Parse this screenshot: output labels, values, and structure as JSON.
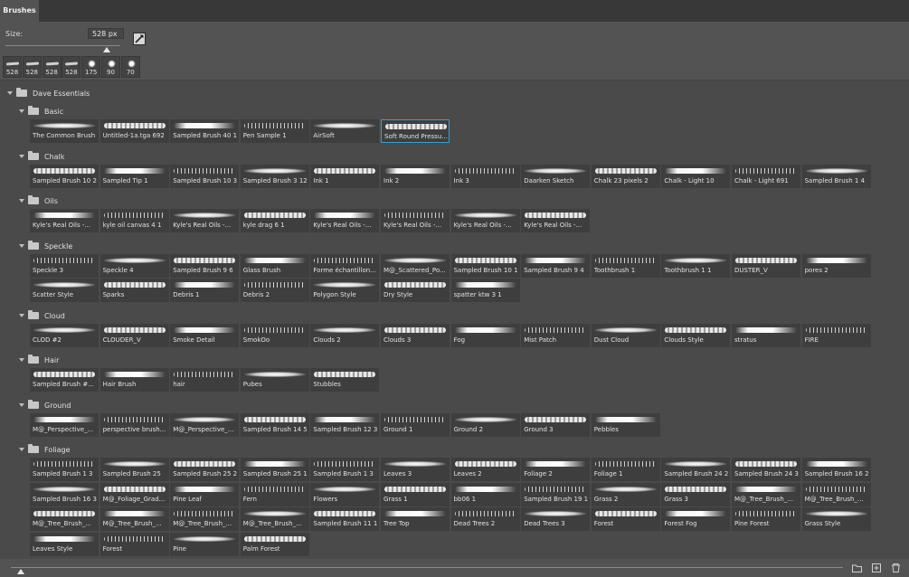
{
  "panel": {
    "tab_label": "Brushes"
  },
  "size": {
    "label": "Size:",
    "value": "528 px",
    "slider_fraction": 0.88
  },
  "presets": [
    {
      "label": "528",
      "kind": "stroke"
    },
    {
      "label": "528",
      "kind": "stroke"
    },
    {
      "label": "528",
      "kind": "stroke"
    },
    {
      "label": "528",
      "kind": "stroke"
    },
    {
      "label": "175",
      "kind": "splat"
    },
    {
      "label": "90",
      "kind": "splat"
    },
    {
      "label": "70",
      "kind": "splat"
    }
  ],
  "root_group": "Dave Essentials",
  "groups": [
    {
      "name": "Basic",
      "rows": [
        [
          "The Common Brush",
          "Untitled-1a.tga 692",
          "Sampled Brush 40 1",
          "Pen Sample 1",
          "AirSoft",
          "Soft Round Pressu..."
        ]
      ],
      "selected": 5
    },
    {
      "name": "Chalk",
      "rows": [
        [
          "Sampled Brush 10 2",
          "Sampled Tip 1",
          "Sampled Brush 10 3",
          "Sampled Brush 3 12",
          "Ink 1",
          "Ink 2",
          "Ink 3",
          "Daarken Sketch",
          "Chalk 23 pixels 2",
          "Chalk - Light 10",
          "Chalk - Light 691",
          "Sampled Brush 1 4"
        ]
      ]
    },
    {
      "name": "Oils",
      "rows": [
        [
          "Kyle's Real Oils -...",
          "kyle oil canvas 4 1",
          "Kyle's Real Oils -...",
          "kyle drag 6 1",
          "Kyle's Real Oils -...",
          "Kyle's Real Oils -...",
          "Kyle's Real Oils -...",
          "Kyle's Real Oils -..."
        ]
      ]
    },
    {
      "name": "Speckle",
      "rows": [
        [
          "Speckle 3",
          "Speckle 4",
          "Sampled Brush 9 6",
          "Glass Brush",
          "Forme  échantillon...",
          "M@_Scattered_Po...",
          "Sampled Brush 10 1",
          "Sampled Brush 9 4",
          "Toothbrush 1",
          "Toothbrush 1 1",
          "DUSTER_V",
          "pores 2"
        ],
        [
          "Scatter Style",
          "Sparks",
          "Debris 1",
          "Debris 2",
          "Polygon Style",
          "Dry Style",
          "spatter ktw 3 1"
        ]
      ]
    },
    {
      "name": "Cloud",
      "rows": [
        [
          "CLOD #2",
          "CLOUDER_V",
          "Smoke Detail",
          "SmokOo",
          "Clouds 2",
          "Clouds 3",
          "Fog",
          "Mist Patch",
          "Dust Cloud",
          "Clouds Style",
          "stratus",
          "FIRE"
        ]
      ]
    },
    {
      "name": "Hair",
      "rows": [
        [
          "Sampled Brush #...",
          "Hair Brush",
          "hair",
          "Pubes",
          "Stubbles"
        ]
      ]
    },
    {
      "name": "Ground",
      "rows": [
        [
          "M@_Perspective_...",
          "perspective brush...",
          "M@_Perspective_...",
          "Sampled Brush 14 5",
          "Sampled Brush 12 3",
          "Ground 1",
          "Ground 2",
          "Ground 3",
          "Pebbles"
        ]
      ]
    },
    {
      "name": "Foliage",
      "rows": [
        [
          "Sampled Brush 1 3",
          "Sampled Brush 25",
          "Sampled Brush 25 2",
          "Sampled Brush 25 1",
          "Sampled Brush 1 3",
          "Leaves 3",
          "Leaves 2",
          "Foliage 2",
          "Foliage 1",
          "Sampled Brush 24 2",
          "Sampled Brush 24 3",
          "Sampled Brush 16 2"
        ],
        [
          "Sampled Brush 16 3",
          "M@_Foliage_Grad...",
          "Pine Leaf",
          "Fern",
          "Flowers",
          "Grass 1",
          "bb06 1",
          "Sampled Brush 19 1",
          "Grass 2",
          "Grass 3",
          "M@_Tree_Brush_...",
          "M@_Tree_Brush_..."
        ],
        [
          "M@_Tree_Brush_...",
          "M@_Tree_Brush_...",
          "M@_Tree_Brush_...",
          "M@_Tree_Brush_...",
          "Sampled Brush 11 1",
          "Tree Top",
          "Dead Trees 2",
          "Dead Trees 3",
          "Forest",
          "Forest Fog",
          "Pine Forest",
          "Grass Style"
        ],
        [
          "Leaves Style",
          "Forest",
          "Pine",
          "Palm Forest"
        ]
      ]
    }
  ],
  "colors": {
    "panel": "#535353",
    "list": "#4a4a4a",
    "tile": "#3e3e3e",
    "selection": "#3a9fd6"
  },
  "icons": {
    "folder": "folder-icon",
    "new_group": "new-group-icon",
    "new_brush": "new-brush-icon",
    "delete": "trash-icon",
    "settings": "brush-settings-icon"
  }
}
